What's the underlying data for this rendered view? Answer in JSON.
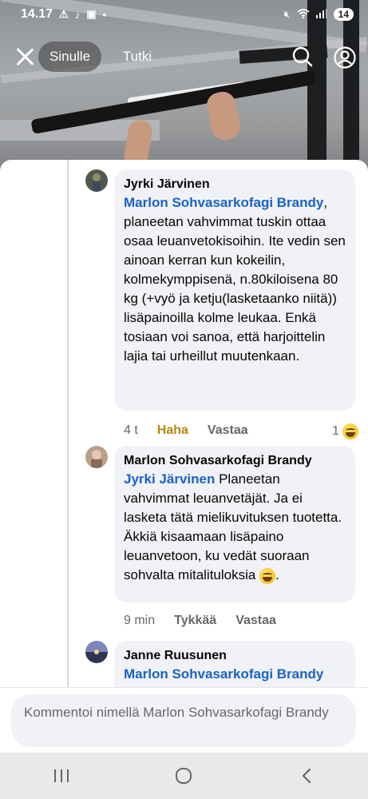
{
  "status_bar": {
    "time": "14.17",
    "battery": "14"
  },
  "top_bar": {
    "tab_active": "Sinulle",
    "tab_other": "Tutki"
  },
  "comments": [
    {
      "author": "Jyrki Järvinen",
      "mention": "Marlon Sohvasarkofagi Brandy",
      "text": ", planeetan vahvimmat tuskin ottaa osaa leuanvetokisoihin. Ite vedin sen ainoan kerran kun kokeilin, kolmekymppisenä, n.80kiloisena 80 kg (+vyö ja ketju(lasketaanko niitä)) lisäpainoilla kolme leukaa. Enkä tosiaan voi sanoa, että harjoittelin lajia tai urheillut muutenkaan.",
      "time": "4 t",
      "reaction_label": "Haha",
      "reply_label": "Vastaa",
      "reaction_count": "1"
    },
    {
      "author": "Marlon Sohvasarkofagi Brandy",
      "mention": "Jyrki Järvinen",
      "text": " Planeetan vahvimmat leuanvetäjät. Ja ei lasketa tätä mielikuvituksen tuotetta. Äkkiä kisaamaan lisäpaino leuanvetoon, ku vedät suoraan sohvalta mitalituloksia ",
      "text_end": ".",
      "time": "9 min",
      "like_label": "Tykkää",
      "reply_label": "Vastaa"
    },
    {
      "author": "Janne Ruusunen",
      "mention": "Marlon Sohvasarkofagi Brandy"
    }
  ],
  "input": {
    "placeholder": "Kommentoi nimellä Marlon Sohvasarkofagi Brandy"
  },
  "colors": {
    "mention": "#1a62c9",
    "haha": "#b5890c",
    "bubble": "#f0f2f5"
  }
}
